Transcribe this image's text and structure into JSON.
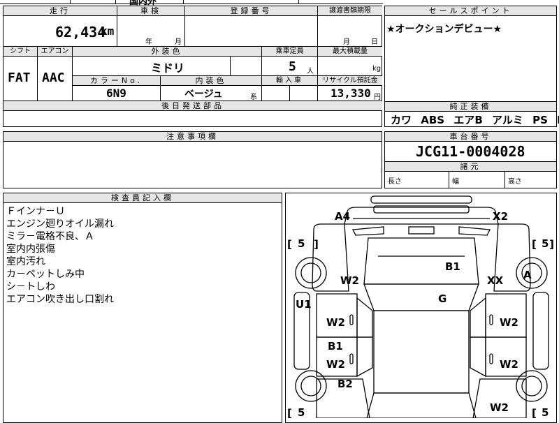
{
  "top_strip": {
    "partial": "国内外"
  },
  "row1": {
    "mileage": {
      "label": "走行",
      "value": "62,434",
      "unit": "km"
    },
    "inspection": {
      "label": "車検",
      "year": "年",
      "month": "月"
    },
    "registration": {
      "label": "登録番号"
    },
    "transfer_deadline": {
      "label": "譲渡書類期限",
      "month": "月",
      "day": "日"
    }
  },
  "row2": {
    "shift": {
      "label": "シフト",
      "value": "FAT"
    },
    "aircon": {
      "label": "エアコン",
      "value": "AAC"
    },
    "exterior_color": {
      "label": "外装色",
      "value": "ミドリ"
    },
    "capacity": {
      "label": "乗車定員",
      "value": "5",
      "unit": "人"
    },
    "max_load": {
      "label": "最大積載量",
      "unit": "kg"
    }
  },
  "row3": {
    "color_no": {
      "label": "カラーNo.",
      "value": "6N9"
    },
    "interior_color": {
      "label": "内装色",
      "value": "ベージュ",
      "suffix": "系"
    },
    "import": {
      "label": "輸入車"
    },
    "recycle": {
      "label": "リサイクル預託金",
      "value": "13,330",
      "unit": "円"
    }
  },
  "later_parts": {
    "label": "後日発送部品"
  },
  "sales_point": {
    "label": "セールスポイント",
    "text": "★オークションデビュー★"
  },
  "equipment": {
    "label": "純正装備",
    "items": [
      "カワ",
      "ABS",
      "エアB",
      "アルミ",
      "PS",
      "PW"
    ]
  },
  "notes": {
    "label": "注意事項欄"
  },
  "chassis": {
    "label": "車台番号",
    "value": "JCG11-0004028"
  },
  "dimensions": {
    "label": "諸元",
    "length": "長さ",
    "width": "幅",
    "height": "高さ"
  },
  "inspector": {
    "label": "検査員記入欄",
    "lines": [
      "Ｆインナ－Ｕ",
      "エンジン廻りオイル漏れ",
      "ミラ－電格不良、Ａ",
      "室内内張傷",
      "室内汚れ",
      "カ－ペットしみ中",
      "シ－トしわ",
      "エアコン吹き出し口割れ"
    ]
  },
  "diagram": {
    "codes": {
      "a4": "A4",
      "x2": "X2",
      "tire_fl": "5",
      "tire_fr": "5",
      "tire_rl": "5",
      "tire_rr": "5",
      "b1_hood": "B1",
      "w2_front_left": "W2",
      "xx_right": "XX",
      "a_mirror": "A",
      "u1_left": "U1",
      "g_glass": "G",
      "w2_door_fl": "W2",
      "w2_door_fr": "W2",
      "b1_door_rl": "B1",
      "w2_door_rl": "W2",
      "w2_door_rr": "W2",
      "b2_rear_left": "B2",
      "w2_rear_right": "W2"
    }
  }
}
